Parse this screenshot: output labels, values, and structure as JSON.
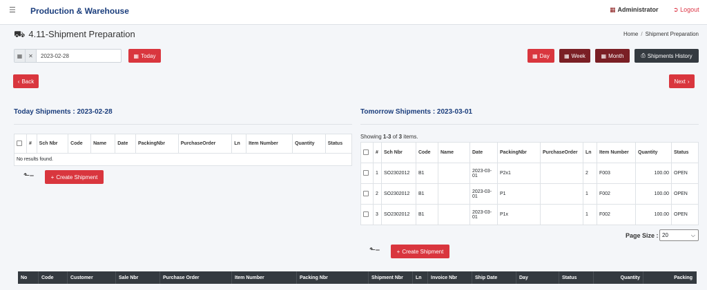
{
  "nav": {
    "brand": "Production & Warehouse",
    "admin_label": "Administrator",
    "logout_label": "Logout"
  },
  "page": {
    "title": "4.11-Shipment Preparation",
    "breadcrumb_home": "Home",
    "breadcrumb_current": "Shipment Preparation"
  },
  "toolbar": {
    "date_value": "2023-02-28",
    "today_label": "Today",
    "day_label": "Day",
    "week_label": "Week",
    "month_label": "Month",
    "history_label": "Shipments History",
    "back_label": "Back",
    "next_label": "Next"
  },
  "today": {
    "title": "Today Shipments : 2023-02-28",
    "headers": [
      "#",
      "Sch Nbr",
      "Code",
      "Name",
      "Date",
      "PackingNbr",
      "PurchaseOrder",
      "Ln",
      "Item Number",
      "Quantity",
      "Status"
    ],
    "empty_text": "No results found.",
    "create_label": "Create Shipment"
  },
  "tomorrow": {
    "title": "Tomorrow Shipments : 2023-03-01",
    "showing_prefix": "Showing ",
    "showing_range": "1-3",
    "showing_of": " of ",
    "showing_total": "3",
    "showing_suffix": " items.",
    "headers": [
      "#",
      "Sch Nbr",
      "Code",
      "Name",
      "Date",
      "PackingNbr",
      "PurchaseOrder",
      "Ln",
      "Item Number",
      "Quantity",
      "Status"
    ],
    "rows": [
      {
        "n": "1",
        "sch": "SO2302012",
        "code": "B1",
        "name": "",
        "date": "2023-03-01",
        "packing": "P2x1",
        "po": "",
        "ln": "2",
        "item": "F003",
        "qty": "100.00",
        "status": "OPEN"
      },
      {
        "n": "2",
        "sch": "SO2302012",
        "code": "B1",
        "name": "",
        "date": "2023-03-01",
        "packing": "P1",
        "po": "",
        "ln": "1",
        "item": "F002",
        "qty": "100.00",
        "status": "OPEN"
      },
      {
        "n": "3",
        "sch": "SO2302012",
        "code": "B1",
        "name": "",
        "date": "2023-03-01",
        "packing": "P1x",
        "po": "",
        "ln": "1",
        "item": "F002",
        "qty": "100.00",
        "status": "OPEN"
      }
    ],
    "create_label": "Create Shipment",
    "page_size_label": "Page Size :",
    "page_size_value": "20"
  },
  "bottom_table": {
    "headers": [
      "No",
      "Code",
      "Customer",
      "Sale Nbr",
      "Purchase Order",
      "Item Number",
      "Packing Nbr",
      "Shipment Nbr",
      "Ln",
      "Invoice Nbr",
      "Ship Date",
      "Day",
      "Status",
      "Quantity",
      "Packing"
    ]
  },
  "colors": {
    "brand": "#1a3d7c",
    "danger": "#d9363e",
    "maroon": "#7a1f25",
    "dark": "#343a40"
  }
}
